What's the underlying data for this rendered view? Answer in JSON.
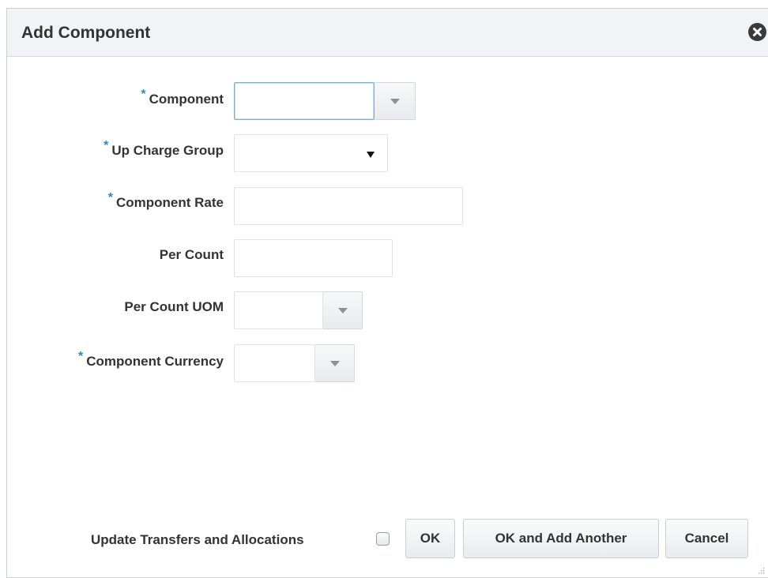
{
  "dialog": {
    "title": "Add Component",
    "close_icon": "close-circle-icon"
  },
  "form": {
    "required_marker": "*",
    "component": {
      "label": "Component",
      "value": "",
      "required": true
    },
    "up_charge_group": {
      "label": "Up Charge Group",
      "value": "",
      "required": true
    },
    "component_rate": {
      "label": "Component Rate",
      "value": "",
      "required": true
    },
    "per_count": {
      "label": "Per Count",
      "value": "",
      "required": false
    },
    "per_count_uom": {
      "label": "Per Count UOM",
      "value": "",
      "required": false
    },
    "component_currency": {
      "label": "Component Currency",
      "value": "",
      "required": true
    }
  },
  "footer": {
    "update_label": "Update Transfers and Allocations",
    "update_checked": false,
    "ok_label": "OK",
    "ok_add_another_label": "OK and Add Another",
    "cancel_label": "Cancel"
  },
  "colors": {
    "required_marker": "#2d87c4",
    "header_bg": "#f1f3f5",
    "focus_border": "#7aaed6"
  }
}
